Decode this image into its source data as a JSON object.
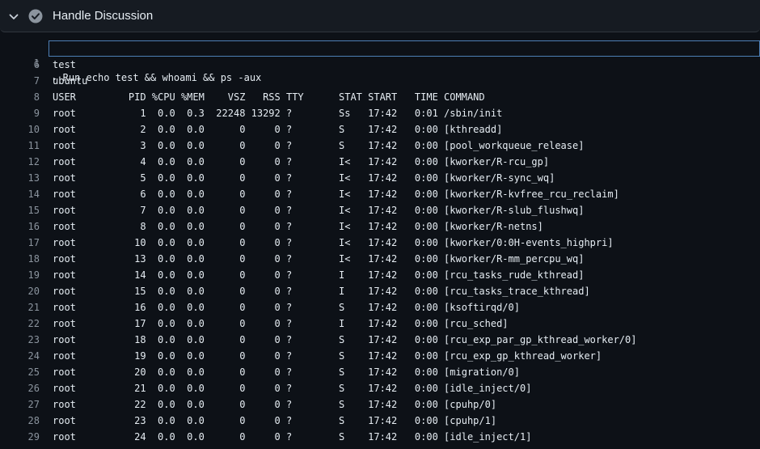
{
  "step": {
    "title": "Handle Discussion"
  },
  "log": {
    "command_line": {
      "number": "1",
      "marker": "▸",
      "text": " Run echo test && whoami && ps -aux"
    },
    "lines": [
      {
        "number": "6",
        "text": "test"
      },
      {
        "number": "7",
        "text": "ubuntu"
      },
      {
        "number": "8",
        "text": "USER         PID %CPU %MEM    VSZ   RSS TTY      STAT START   TIME COMMAND"
      },
      {
        "number": "9",
        "text": "root           1  0.0  0.3  22248 13292 ?        Ss   17:42   0:01 /sbin/init"
      },
      {
        "number": "10",
        "text": "root           2  0.0  0.0      0     0 ?        S    17:42   0:00 [kthreadd]"
      },
      {
        "number": "11",
        "text": "root           3  0.0  0.0      0     0 ?        S    17:42   0:00 [pool_workqueue_release]"
      },
      {
        "number": "12",
        "text": "root           4  0.0  0.0      0     0 ?        I<   17:42   0:00 [kworker/R-rcu_gp]"
      },
      {
        "number": "13",
        "text": "root           5  0.0  0.0      0     0 ?        I<   17:42   0:00 [kworker/R-sync_wq]"
      },
      {
        "number": "14",
        "text": "root           6  0.0  0.0      0     0 ?        I<   17:42   0:00 [kworker/R-kvfree_rcu_reclaim]"
      },
      {
        "number": "15",
        "text": "root           7  0.0  0.0      0     0 ?        I<   17:42   0:00 [kworker/R-slub_flushwq]"
      },
      {
        "number": "16",
        "text": "root           8  0.0  0.0      0     0 ?        I<   17:42   0:00 [kworker/R-netns]"
      },
      {
        "number": "17",
        "text": "root          10  0.0  0.0      0     0 ?        I<   17:42   0:00 [kworker/0:0H-events_highpri]"
      },
      {
        "number": "18",
        "text": "root          13  0.0  0.0      0     0 ?        I<   17:42   0:00 [kworker/R-mm_percpu_wq]"
      },
      {
        "number": "19",
        "text": "root          14  0.0  0.0      0     0 ?        I    17:42   0:00 [rcu_tasks_rude_kthread]"
      },
      {
        "number": "20",
        "text": "root          15  0.0  0.0      0     0 ?        I    17:42   0:00 [rcu_tasks_trace_kthread]"
      },
      {
        "number": "21",
        "text": "root          16  0.0  0.0      0     0 ?        S    17:42   0:00 [ksoftirqd/0]"
      },
      {
        "number": "22",
        "text": "root          17  0.0  0.0      0     0 ?        I    17:42   0:00 [rcu_sched]"
      },
      {
        "number": "23",
        "text": "root          18  0.0  0.0      0     0 ?        S    17:42   0:00 [rcu_exp_par_gp_kthread_worker/0]"
      },
      {
        "number": "24",
        "text": "root          19  0.0  0.0      0     0 ?        S    17:42   0:00 [rcu_exp_gp_kthread_worker]"
      },
      {
        "number": "25",
        "text": "root          20  0.0  0.0      0     0 ?        S    17:42   0:00 [migration/0]"
      },
      {
        "number": "26",
        "text": "root          21  0.0  0.0      0     0 ?        S    17:42   0:00 [idle_inject/0]"
      },
      {
        "number": "27",
        "text": "root          22  0.0  0.0      0     0 ?        S    17:42   0:00 [cpuhp/0]"
      },
      {
        "number": "28",
        "text": "root          23  0.0  0.0      0     0 ?        S    17:42   0:00 [cpuhp/1]"
      },
      {
        "number": "29",
        "text": "root          24  0.0  0.0      0     0 ?        S    17:42   0:00 [idle_inject/1]"
      }
    ]
  },
  "colors": {
    "background": "#0d1117",
    "header_bg": "#161b22",
    "line_number": "#8b949e",
    "text": "#e6edf3",
    "highlight_border": "#4d7fb5"
  },
  "icons": {
    "collapse": "chevron-down-icon",
    "status": "check-circle-icon"
  }
}
